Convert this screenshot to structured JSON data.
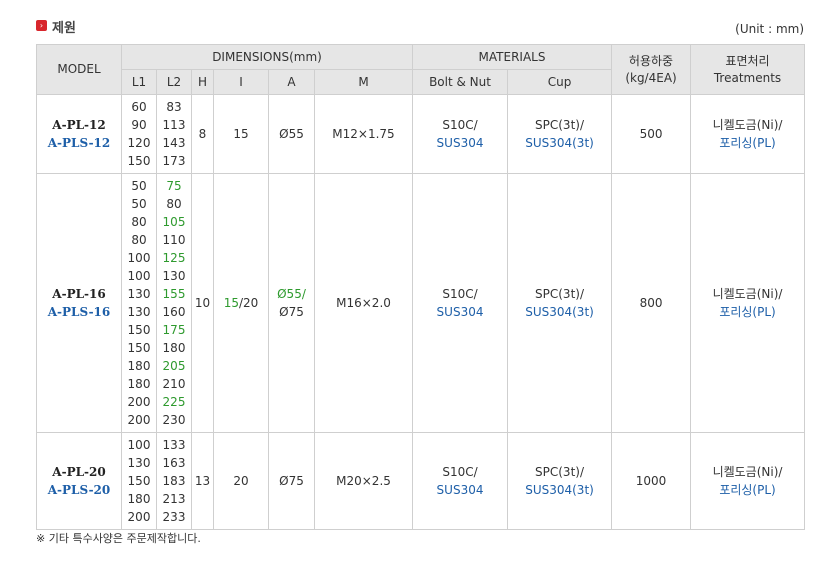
{
  "section": {
    "marker_glyph": "›",
    "title": "제원",
    "unit": "(Unit : mm)"
  },
  "headers": {
    "model": "MODEL",
    "dimensions": "DIMENSIONS(mm)",
    "materials": "MATERIALS",
    "load": [
      "허용하중",
      "(kg/4EA)"
    ],
    "treatment": [
      "표면처리",
      "Treatments"
    ],
    "sub": {
      "l1": "L1",
      "l2": "L2",
      "h": "H",
      "i": "I",
      "a": "A",
      "m": "M",
      "bolt": "Bolt & Nut",
      "cup": "Cup"
    }
  },
  "rows": [
    {
      "model": [
        "A-PL-12",
        "A-PLS-12"
      ],
      "l1": [
        "60",
        "90",
        "120",
        "150"
      ],
      "l2": [
        "83",
        "113",
        "143",
        "173"
      ],
      "h": "8",
      "i": "15",
      "a": "Ø55",
      "m": "M12×1.75",
      "bolt": [
        "S10C/",
        "SUS304"
      ],
      "cup": [
        "SPC(3t)/",
        "SUS304(3t)"
      ],
      "load": "500",
      "treatment": [
        "니켈도금(Ni)/",
        "포리싱(PL)"
      ]
    },
    {
      "model": [
        "A-PL-16",
        "A-PLS-16"
      ],
      "l1": [
        "50",
        "50",
        "80",
        "80",
        "100",
        "100",
        "130",
        "130",
        "150",
        "150",
        "180",
        "180",
        "200",
        "200"
      ],
      "l2": [
        "75",
        "80",
        "105",
        "110",
        "125",
        "130",
        "155",
        "160",
        "175",
        "180",
        "205",
        "210",
        "225",
        "230"
      ],
      "h": "10",
      "i": [
        "15",
        "/20"
      ],
      "a": [
        "Ø55/",
        "Ø75"
      ],
      "m": "M16×2.0",
      "bolt": [
        "S10C/",
        "SUS304"
      ],
      "cup": [
        "SPC(3t)/",
        "SUS304(3t)"
      ],
      "load": "800",
      "treatment": [
        "니켈도금(Ni)/",
        "포리싱(PL)"
      ]
    },
    {
      "model": [
        "A-PL-20",
        "A-PLS-20"
      ],
      "l1": [
        "100",
        "130",
        "150",
        "180",
        "200"
      ],
      "l2": [
        "133",
        "163",
        "183",
        "213",
        "233"
      ],
      "h": "13",
      "i": "20",
      "a": "Ø75",
      "m": "M20×2.5",
      "bolt": [
        "S10C/",
        "SUS304"
      ],
      "cup": [
        "SPC(3t)/",
        "SUS304(3t)"
      ],
      "load": "1000",
      "treatment": [
        "니켈도금(Ni)/",
        "포리싱(PL)"
      ]
    }
  ],
  "colors": {
    "accent_red": "#d8262c",
    "blue": "#1e5fa8",
    "green": "#2e9a2e",
    "header_bg": "#e6e6e6"
  },
  "note": "※ 기타 특수사양은 주문제작합니다."
}
